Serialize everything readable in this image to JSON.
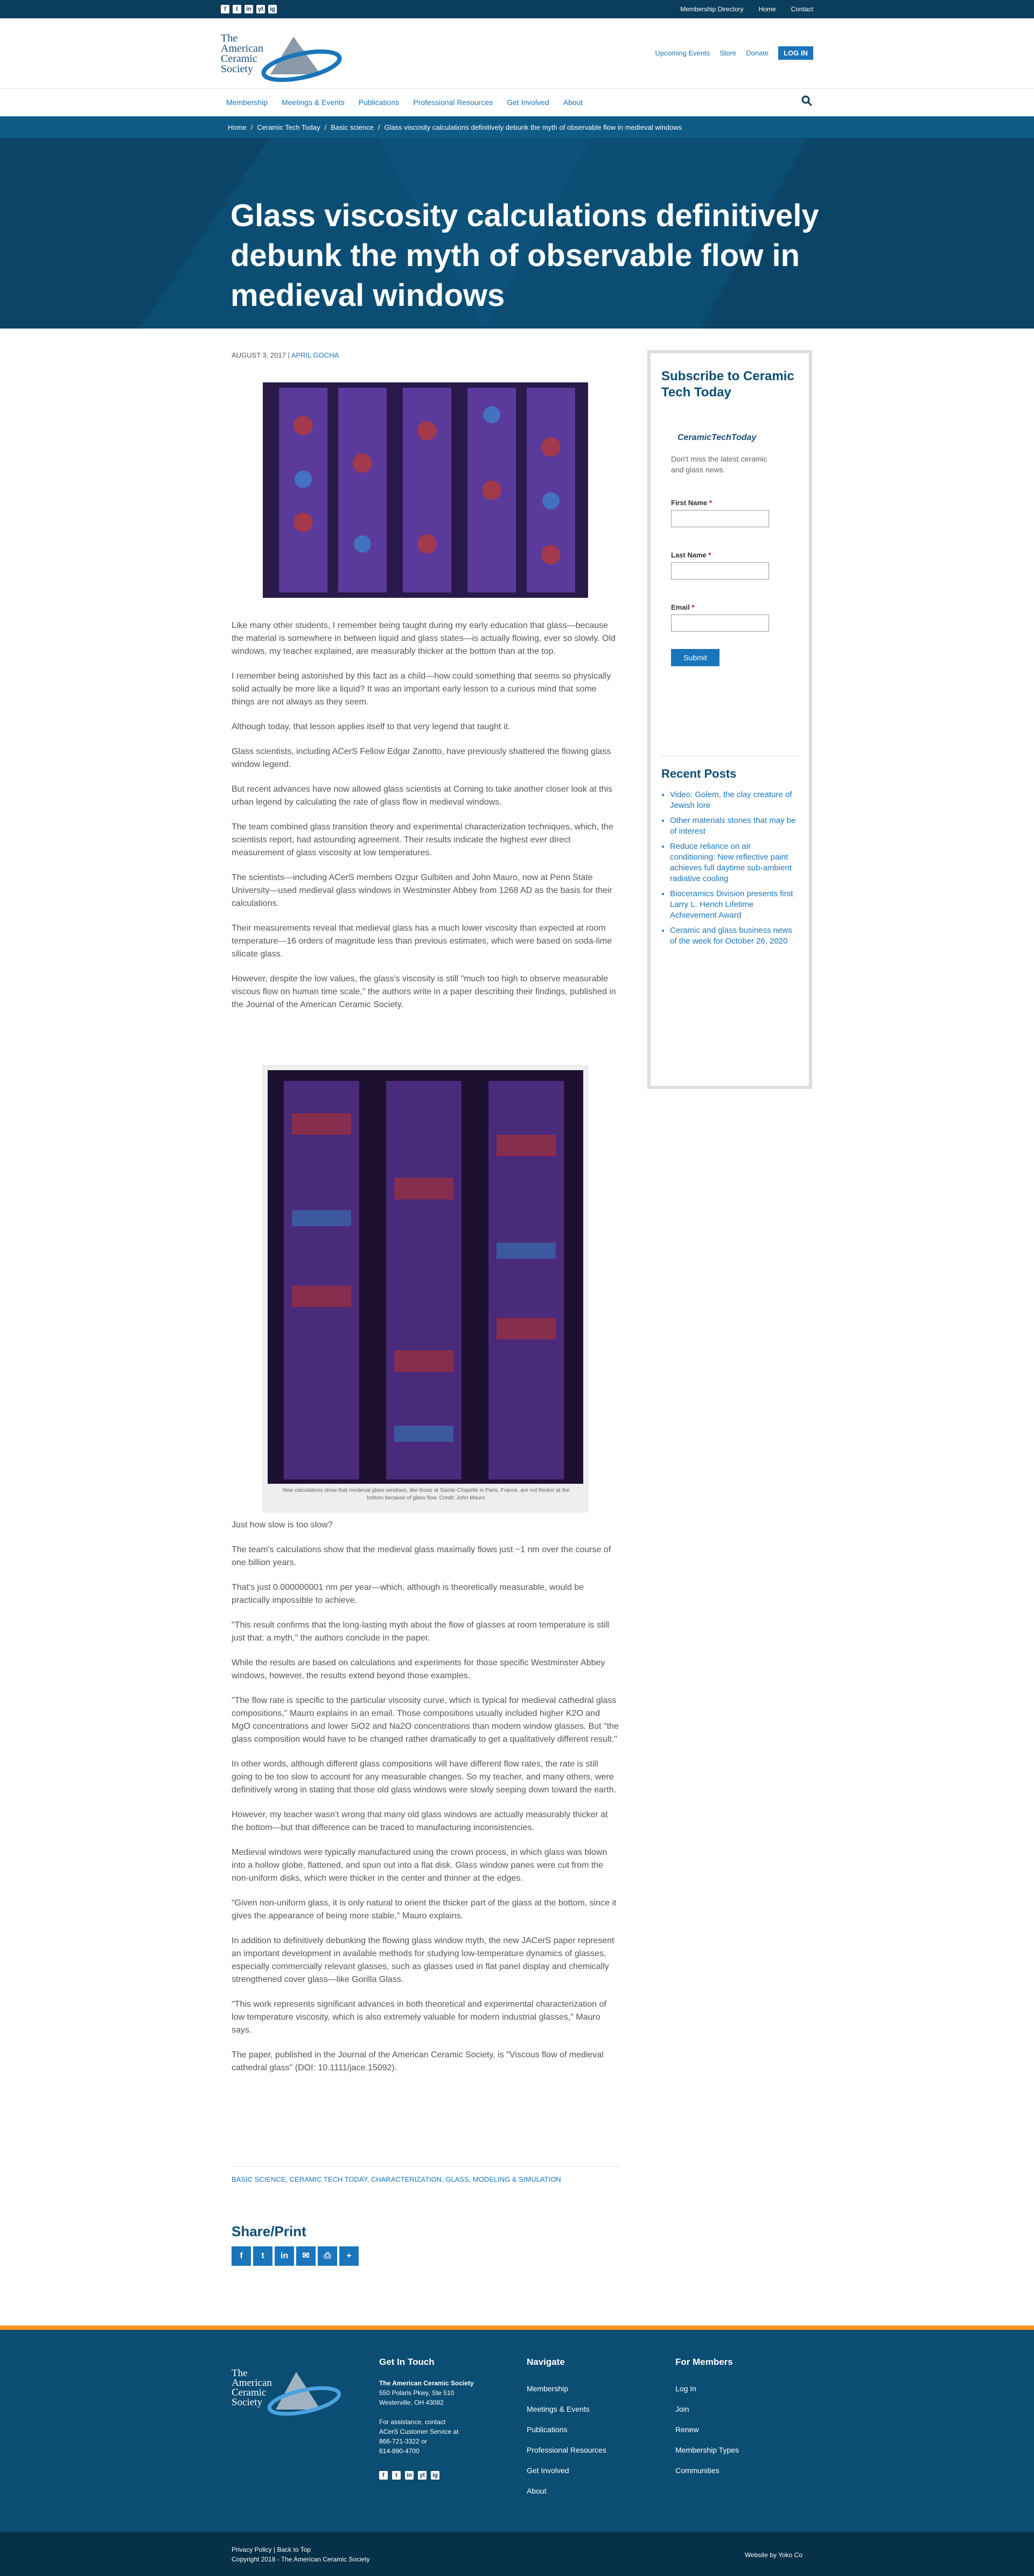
{
  "topbar": {
    "social": [
      "f",
      "t",
      "in",
      "yt",
      "ig"
    ],
    "links": [
      "Membership Directory",
      "Home",
      "Contact"
    ]
  },
  "header": {
    "logo_text": [
      "The",
      "American",
      "Ceramic",
      "Society"
    ],
    "nav": [
      "Upcoming Events",
      "Store",
      "Donate"
    ],
    "login": "LOG IN"
  },
  "mainnav": [
    "Membership",
    "Meetings & Events",
    "Publications",
    "Professional Resources",
    "Get Involved",
    "About"
  ],
  "breadcrumb": [
    "Home",
    "/",
    "Ceramic Tech Today",
    "/",
    "Basic science",
    "/",
    "Glass viscosity calculations definitively debunk the myth of observable flow in medieval windows"
  ],
  "hero": {
    "title": "Glass viscosity calculations definitively debunk the myth of observable flow in medieval windows"
  },
  "meta": {
    "date": "AUGUST 3, 2017 |",
    "author": "APRIL GOCHA"
  },
  "article": {
    "p1": "Like many other students, I remember being taught during my early education that glass—because the material is somewhere in between liquid and glass states—is actually flowing, ever so slowly. Old windows, my teacher explained, are measurably thicker at the bottom than at the top.",
    "p2": "I remember being astonished by this fact as a child—how could something that seems so physically solid actually be more like a liquid? It was an important early lesson to a curious mind that some things are not always as they seem.",
    "p3": "Although today, that lesson applies itself to that very legend that taught it.",
    "p4": "Glass scientists, including ACerS Fellow Edgar Zanotto, have previously shattered the flowing glass window legend.",
    "p5": "But recent advances have now allowed glass scientists at Corning to take another closer look at this urban legend by calculating the rate of glass flow in medieval windows.",
    "p6": "The team combined glass transition theory and experimental characterization techniques, which, the scientists report, had astounding agreement. Their results indicate the highest ever direct measurement of glass viscosity at low temperatures.",
    "p7": "The scientists—including ACerS members Ozgur Gulbiten and John Mauro, now at Penn State University—used medieval glass windows in Westminster Abbey from 1268 AD as the basis for their calculations.",
    "p8": "Their measurements reveal that medieval glass has a much lower viscosity than expected at room temperature—16 orders of magnitude less than previous estimates, which were based on soda-lime silicate glass.",
    "p9": "However, despite the low values, the glass's viscosity is still \"much too high to observe measurable viscous flow on human time scale,\" the authors write in a paper describing their findings, published in the Journal of the American Ceramic Society.",
    "caption": "New calculations show that medieval glass windows, like those at Sainte-Chapelle in Paris, France, are not thicker at the bottom because of glass flow. Credit: John Mauro",
    "q1": "Just how slow is too slow?",
    "q2": "The team's calculations show that the medieval glass maximally flows just ~1 nm over the course of one billion years.",
    "q3": "That's just 0.000000001 nm per year—which, although is theoretically measurable, would be practically impossible to achieve.",
    "q4": "\"This result confirms that the long-lasting myth about the flow of glasses at room temperature is still just that: a myth,\" the authors conclude in the paper.",
    "q5": "While the results are based on calculations and experiments for those specific Westminster Abbey windows, however, the results extend beyond those examples.",
    "q6": "\"The flow rate is specific to the particular viscosity curve, which is typical for medieval cathedral glass compositions,\" Mauro explains in an email. Those compositions usually included higher K2O and MgO concentrations and lower SiO2 and Na2O concentrations than modern window glasses. But \"the glass composition would have to be changed rather dramatically to get a qualitatively different result.\"",
    "q7": "In other words, although different glass compositions will have different flow rates, the rate is still going to be too slow to account for any measurable changes. So my teacher, and many others, were definitively wrong in stating that those old glass windows were slowly seeping down toward the earth.",
    "q8": "However, my teacher wasn't wrong that many old glass windows are actually measurably thicker at the bottom—but that difference can be traced to manufacturing inconsistencies.",
    "q9": "Medieval windows were typically manufactured using the crown process, in which glass was blown into a hollow globe, flattened, and spun out into a flat disk. Glass window panes were cut from the non-uniform disks, which were thicker in the center and thinner at the edges.",
    "q10": "\"Given non-uniform glass, it is only natural to orient the thicker part of the glass at the bottom, since it gives the appearance of being more stable,\" Mauro explains.",
    "q11": "In addition to definitively debunking the flowing glass window myth, the new JACerS paper represent an important development in available methods for studying low-temperature dynamics of glasses, especially commercially relevant glasses, such as glasses used in flat panel display and chemically strengthened cover glass—like Gorilla Glass.",
    "q12": "\"This work represents significant advances in both theoretical and experimental characterization of low temperature viscosity, which is also extremely valuable for modern industrial glasses,\" Mauro says.",
    "q13": "The paper, published in the Journal of the American Ceramic Society, is \"Viscous flow of medieval cathedral glass\" (DOI: 10.1111/jace.15092)."
  },
  "tags": "BASIC SCIENCE, CERAMIC TECH TODAY, CHARACTERIZATION, GLASS, MODELING & SIMULATION",
  "share": {
    "title": "Share/Print",
    "buttons": [
      "f",
      "t",
      "in",
      "✉",
      "⎙",
      "+"
    ]
  },
  "sidebar": {
    "title": "Subscribe to Ceramic Tech Today",
    "logo": "CeramicTechToday",
    "desc": "Don't miss the latest ceramic and glass news.",
    "first": "First Name",
    "last": "Last Name",
    "email": "Email",
    "req": "*",
    "submit": "Submit",
    "recent_title": "Recent Posts",
    "recent": [
      "Video: Golem, the clay creature of Jewish lore",
      "Other materials stories that may be of interest",
      "Reduce reliance on air conditioning: New reflective paint achieves full daytime sub-ambient radiative cooling",
      "Bioceramics Division presents first Larry L. Hench Lifetime Achievement Award",
      "Ceramic and glass business news of the week for October 26, 2020"
    ]
  },
  "footer": {
    "logo_text": [
      "The",
      "American",
      "Ceramic",
      "Society"
    ],
    "contact_title": "Get In Touch",
    "org": "The American Ceramic Society",
    "addr1": "550 Polaris Pkwy, Ste 510",
    "addr2": "Westerville, OH 43082",
    "assist1": "For assistance, contact",
    "assist2": "ACerS Customer Service at",
    "phone1": "866-721-3322 or",
    "phone2": "614-890-4700",
    "nav_title": "Navigate",
    "nav": [
      "Membership",
      "Meetings & Events",
      "Publications",
      "Professional Resources",
      "Get Involved",
      "About"
    ],
    "members_title": "For Members",
    "members": [
      "Log In",
      "Join",
      "Renew",
      "Membership Types",
      "Communities"
    ],
    "privacy": "Privacy Policy",
    "sep": "|",
    "back": "Back to Top",
    "copyright": "Copyright 2018 - The American Ceramic Society",
    "credit": "Website by Yoko Co"
  }
}
